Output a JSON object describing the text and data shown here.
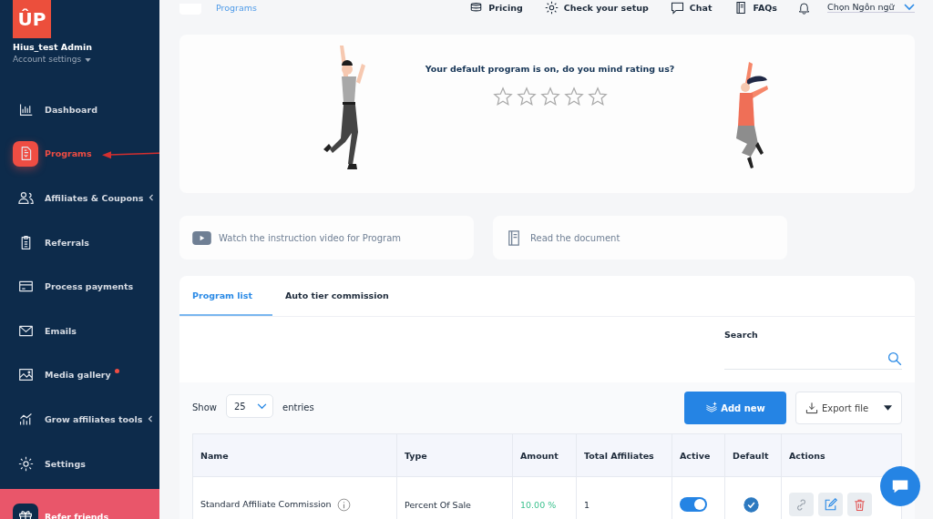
{
  "sidebar": {
    "logo": "ÛP",
    "user": "Hius_test Admin",
    "account_link": "Account settings",
    "items": [
      {
        "label": "Dashboard",
        "selected": false,
        "submenu": false,
        "dot": false
      },
      {
        "label": "Programs",
        "selected": true,
        "submenu": false,
        "dot": false
      },
      {
        "label": "Affiliates & Coupons",
        "selected": false,
        "submenu": true,
        "dot": false
      },
      {
        "label": "Referrals",
        "selected": false,
        "submenu": false,
        "dot": false
      },
      {
        "label": "Process payments",
        "selected": false,
        "submenu": false,
        "dot": false
      },
      {
        "label": "Emails",
        "selected": false,
        "submenu": false,
        "dot": false
      },
      {
        "label": "Media gallery",
        "selected": false,
        "submenu": false,
        "dot": true
      },
      {
        "label": "Grow affiliates tools",
        "selected": false,
        "submenu": true,
        "dot": false
      },
      {
        "label": "Settings",
        "selected": false,
        "submenu": false,
        "dot": false
      }
    ],
    "promo": {
      "label": "Refer friends"
    }
  },
  "header": {
    "breadcrumb": "Programs",
    "links": [
      {
        "label": "Pricing"
      },
      {
        "label": "Check your setup"
      },
      {
        "label": "Chat"
      },
      {
        "label": "FAQs"
      }
    ],
    "language": "Chọn Ngôn ngữ"
  },
  "rating": {
    "question": "Your default program is on, do you mind rating us?",
    "stars": 0
  },
  "help_links": [
    {
      "label": "Watch the instruction video for Program"
    },
    {
      "label": "Read the document"
    }
  ],
  "tabs": [
    {
      "label": "Program list",
      "selected": true
    },
    {
      "label": "Auto tier commission",
      "selected": false
    }
  ],
  "search": {
    "label": "Search"
  },
  "entries": {
    "show": "Show",
    "value": "25",
    "suffix": "entries"
  },
  "buttons": {
    "add": "Add new",
    "export": "Export file"
  },
  "table": {
    "columns": [
      "Name",
      "Type",
      "Amount",
      "Total Affiliates",
      "Active",
      "Default",
      "Actions"
    ],
    "rows": [
      {
        "name": "Standard Affiliate Commission",
        "type": "Percent Of Sale",
        "amount": "10.00 %",
        "total": "1",
        "active": true,
        "default": true
      }
    ]
  }
}
